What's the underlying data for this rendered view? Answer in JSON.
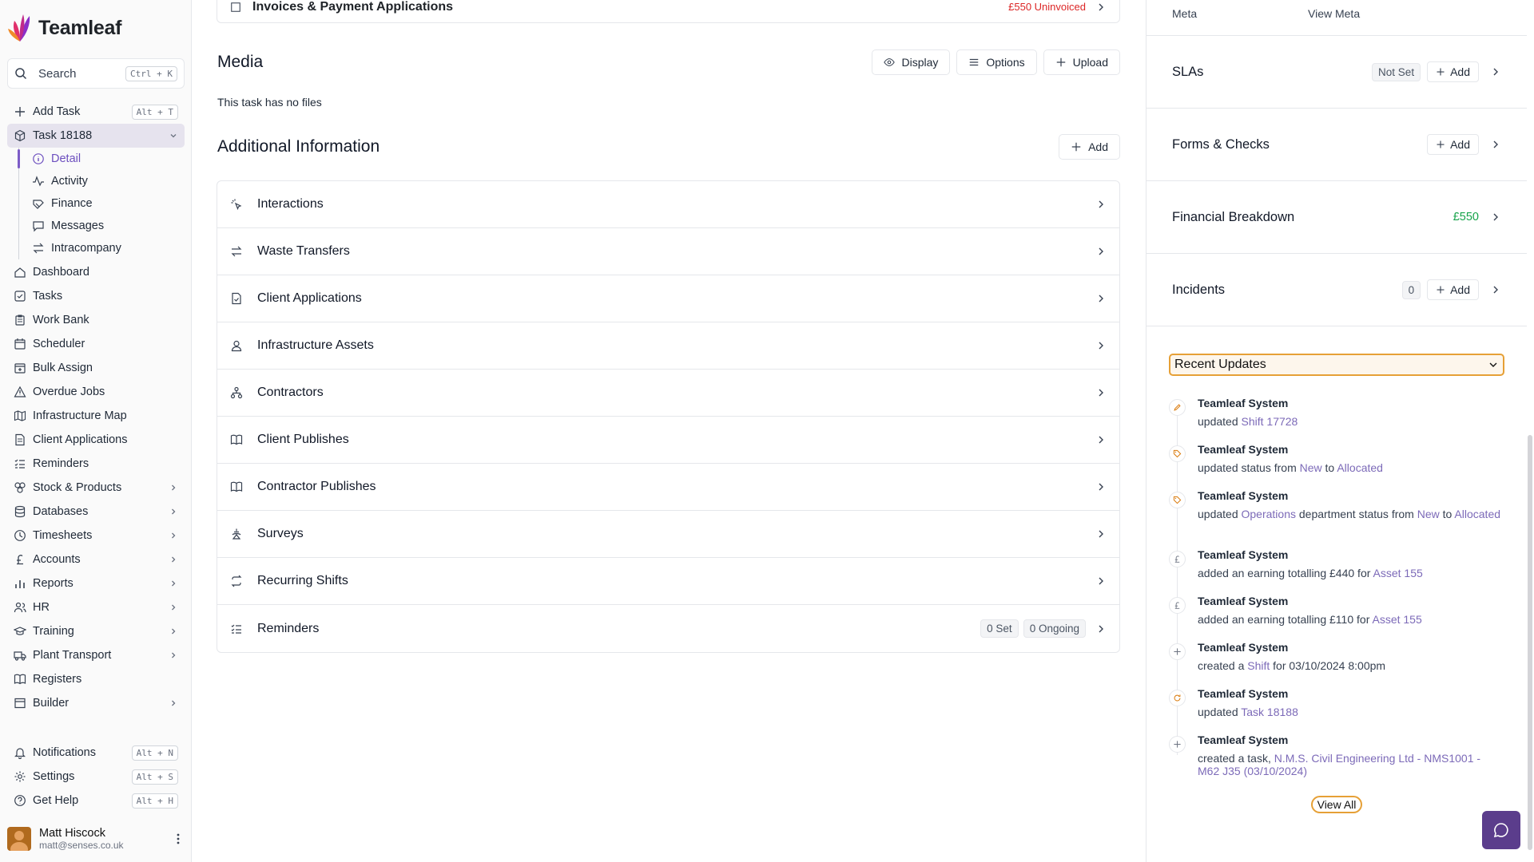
{
  "brand": {
    "name": "Teamleaf"
  },
  "search": {
    "label": "Search",
    "shortcut": "Ctrl + K"
  },
  "nav_top": [
    {
      "label": "Add Task",
      "shortcut": "Alt + T",
      "icon": "plus-icon"
    }
  ],
  "task": {
    "label": "Task 18188"
  },
  "task_sub": [
    {
      "label": "Detail",
      "icon": "info-icon"
    },
    {
      "label": "Activity",
      "icon": "activity-icon"
    },
    {
      "label": "Finance",
      "icon": "finance-icon"
    },
    {
      "label": "Messages",
      "icon": "message-icon"
    },
    {
      "label": "Intracompany",
      "icon": "swap-icon"
    }
  ],
  "nav_main": [
    {
      "label": "Dashboard",
      "icon": "home-icon"
    },
    {
      "label": "Tasks",
      "icon": "checkbox-icon"
    },
    {
      "label": "Work Bank",
      "icon": "clipboard-icon"
    },
    {
      "label": "Scheduler",
      "icon": "calendar-icon"
    },
    {
      "label": "Bulk Assign",
      "icon": "calendar-plus-icon"
    },
    {
      "label": "Overdue Jobs",
      "icon": "warning-icon"
    },
    {
      "label": "Infrastructure Map",
      "icon": "map-icon"
    },
    {
      "label": "Client Applications",
      "icon": "document-icon"
    },
    {
      "label": "Reminders",
      "icon": "list-check-icon"
    },
    {
      "label": "Stock & Products",
      "icon": "boxes-icon",
      "chevron": true
    },
    {
      "label": "Databases",
      "icon": "database-icon",
      "chevron": true
    },
    {
      "label": "Timesheets",
      "icon": "clock-icon",
      "chevron": true
    },
    {
      "label": "Accounts",
      "icon": "pound-icon",
      "chevron": true
    },
    {
      "label": "Reports",
      "icon": "bar-chart-icon",
      "chevron": true
    },
    {
      "label": "HR",
      "icon": "users-icon",
      "chevron": true
    },
    {
      "label": "Training",
      "icon": "graduation-icon",
      "chevron": true
    },
    {
      "label": "Plant Transport",
      "icon": "truck-icon",
      "chevron": true
    },
    {
      "label": "Registers",
      "icon": "book-icon"
    },
    {
      "label": "Builder",
      "icon": "layers-icon",
      "chevron": true
    }
  ],
  "nav_bottom": [
    {
      "label": "Notifications",
      "shortcut": "Alt + N",
      "icon": "bell-icon"
    },
    {
      "label": "Settings",
      "shortcut": "Alt + S",
      "icon": "gear-icon"
    },
    {
      "label": "Get Help",
      "shortcut": "Alt + H",
      "icon": "help-icon"
    }
  ],
  "user": {
    "name": "Matt Hiscock",
    "email": "matt@senses.co.uk"
  },
  "main": {
    "top_row": {
      "label": "Invoices & Payment Applications",
      "status": "£550 Uninvoiced"
    },
    "media": {
      "title": "Media",
      "buttons": [
        "Display",
        "Options",
        "Upload"
      ],
      "empty": "This task has no files"
    },
    "additional": {
      "title": "Additional Information",
      "add_label": "Add",
      "rows": [
        {
          "label": "Interactions",
          "icon": "sparkle-cursor-icon"
        },
        {
          "label": "Waste Transfers",
          "icon": "arrows-swap-icon"
        },
        {
          "label": "Client Applications",
          "icon": "document-check-icon"
        },
        {
          "label": "Infrastructure Assets",
          "icon": "asset-icon"
        },
        {
          "label": "Contractors",
          "icon": "network-icon"
        },
        {
          "label": "Client Publishes",
          "icon": "book-open-icon"
        },
        {
          "label": "Contractor Publishes",
          "icon": "book-open-icon"
        },
        {
          "label": "Surveys",
          "icon": "survey-icon"
        },
        {
          "label": "Recurring Shifts",
          "icon": "repeat-icon"
        },
        {
          "label": "Reminders",
          "icon": "list-check-icon",
          "pills": [
            "0 Set",
            "0 Ongoing"
          ]
        }
      ]
    }
  },
  "right": {
    "meta": {
      "label": "Meta",
      "link": "View Meta"
    },
    "slas": {
      "label": "SLAs",
      "status": "Not Set",
      "add": "Add"
    },
    "forms": {
      "label": "Forms & Checks",
      "add": "Add"
    },
    "financial": {
      "label": "Financial Breakdown",
      "value": "£550"
    },
    "incidents": {
      "label": "Incidents",
      "count": "0",
      "add": "Add"
    },
    "recent": {
      "select": "Recent Updates",
      "view_all": "View All",
      "items": [
        {
          "who": "Teamleaf System",
          "icon": "pencil-icon",
          "parts": [
            [
              "t",
              "updated "
            ],
            [
              "l",
              "Shift 17728"
            ]
          ]
        },
        {
          "who": "Teamleaf System",
          "icon": "tag-icon",
          "parts": [
            [
              "t",
              "updated status from "
            ],
            [
              "l",
              "New"
            ],
            [
              "t",
              " to "
            ],
            [
              "l",
              "Allocated"
            ]
          ]
        },
        {
          "who": "Teamleaf System",
          "icon": "tag-icon",
          "parts": [
            [
              "t",
              "updated "
            ],
            [
              "l",
              "Operations"
            ],
            [
              "t",
              " department status from "
            ],
            [
              "l",
              "New"
            ],
            [
              "t",
              " to "
            ],
            [
              "l",
              "Allocated"
            ]
          ]
        },
        {
          "who": "Teamleaf System",
          "icon": "pound-icon",
          "parts": [
            [
              "t",
              "added an earning totalling £440 for "
            ],
            [
              "l",
              "Asset 155"
            ]
          ]
        },
        {
          "who": "Teamleaf System",
          "icon": "pound-icon",
          "parts": [
            [
              "t",
              "added an earning totalling £110 for "
            ],
            [
              "l",
              "Asset 155"
            ]
          ]
        },
        {
          "who": "Teamleaf System",
          "icon": "plus-icon",
          "parts": [
            [
              "t",
              "created a "
            ],
            [
              "l",
              "Shift"
            ],
            [
              "t",
              "  for 03/10/2024 8:00pm"
            ]
          ]
        },
        {
          "who": "Teamleaf System",
          "icon": "refresh-icon",
          "parts": [
            [
              "t",
              "updated "
            ],
            [
              "l",
              "Task 18188"
            ]
          ]
        },
        {
          "who": "Teamleaf System",
          "icon": "plus-icon",
          "parts": [
            [
              "t",
              "created a task, "
            ],
            [
              "l",
              "N.M.S. Civil Engineering Ltd - NMS1001 - M62 J35 (03/10/2024)"
            ]
          ]
        }
      ]
    }
  },
  "colors": {
    "accent": "#7c5cc7",
    "highlight": "#e6a036",
    "success": "#16a34a",
    "danger": "#dc2626",
    "fab": "#5b3d8c"
  }
}
